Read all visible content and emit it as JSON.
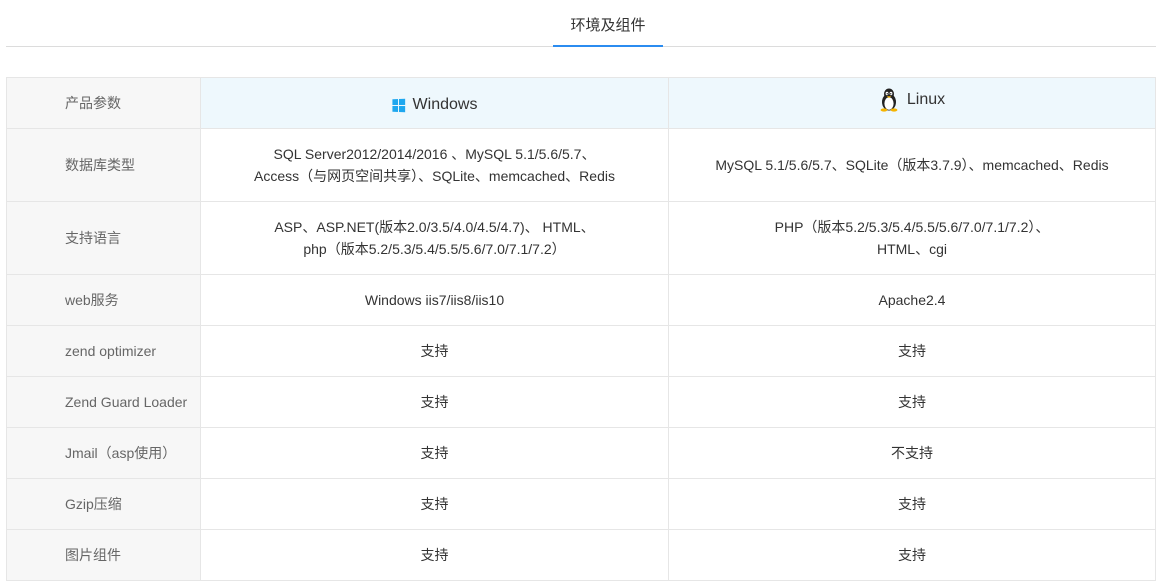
{
  "tabs": {
    "active_label": "环境及组件"
  },
  "table": {
    "header": {
      "param_label": "产品参数",
      "windows_label": "Windows",
      "linux_label": "Linux",
      "windows_icon": "windows-logo-icon",
      "linux_icon": "linux-tux-icon"
    },
    "rows": [
      {
        "label": "数据库类型",
        "windows": [
          "SQL Server2012/2014/2016 、MySQL 5.1/5.6/5.7、",
          "Access（与网页空间共享）、SQLite、memcached、Redis"
        ],
        "linux": [
          "MySQL 5.1/5.6/5.7、SQLite（版本3.7.9）、memcached、Redis"
        ]
      },
      {
        "label": "支持语言",
        "windows": [
          "ASP、ASP.NET(版本2.0/3.5/4.0/4.5/4.7)、 HTML、",
          "php（版本5.2/5.3/5.4/5.5/5.6/7.0/7.1/7.2）"
        ],
        "linux": [
          "PHP（版本5.2/5.3/5.4/5.5/5.6/7.0/7.1/7.2）、",
          "HTML、cgi"
        ]
      },
      {
        "label": "web服务",
        "windows": [
          "Windows iis7/iis8/iis10"
        ],
        "linux": [
          "Apache2.4"
        ]
      },
      {
        "label": "zend optimizer",
        "windows": [
          "支持"
        ],
        "linux": [
          "支持"
        ]
      },
      {
        "label": "Zend Guard Loader",
        "windows": [
          "支持"
        ],
        "linux": [
          "支持"
        ]
      },
      {
        "label": "Jmail（asp使用）",
        "windows": [
          "支持"
        ],
        "linux": [
          "不支持"
        ]
      },
      {
        "label": "Gzip压缩",
        "windows": [
          "支持"
        ],
        "linux": [
          "支持"
        ]
      },
      {
        "label": "图片组件",
        "windows": [
          "支持"
        ],
        "linux": [
          "支持"
        ]
      }
    ]
  },
  "colors": {
    "accent": "#2b8cf0",
    "header_bg": "#eef8fd",
    "label_bg": "#f7f7f7",
    "border": "#e6e6e6",
    "windows_logo": "#1ea7ef"
  }
}
